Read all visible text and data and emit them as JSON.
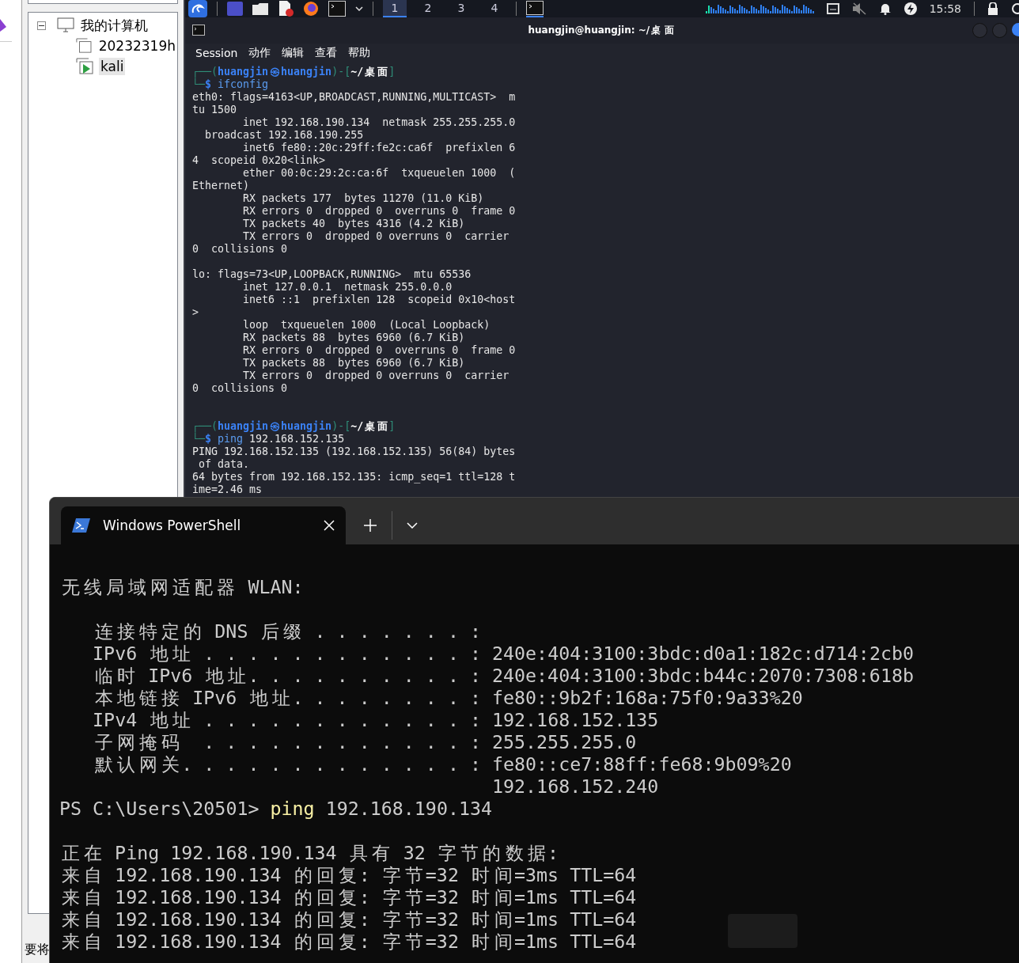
{
  "vm_tree": {
    "root": {
      "label": "我的计算机",
      "expanded": true,
      "children": [
        {
          "label": "20232319h",
          "selected": false,
          "running": false
        },
        {
          "label": "kali",
          "selected": true,
          "running": true
        }
      ]
    }
  },
  "status_text": "要将",
  "kali_panel": {
    "workspaces": [
      {
        "label": "1",
        "selected": true
      },
      {
        "label": "2",
        "selected": false
      },
      {
        "label": "3",
        "selected": false
      },
      {
        "label": "4",
        "selected": false
      }
    ],
    "clock": "15:58"
  },
  "terminal": {
    "title": "huangjin@huangjin: ~/桌面",
    "menu": [
      "Session",
      "动作",
      "编辑",
      "查看",
      "帮助"
    ],
    "lines": [
      {
        "kind": "prompt",
        "segments": [
          {
            "t": "┌──(",
            "kind": "frame"
          },
          {
            "t": "huangjin㉿huangjin",
            "kind": "user"
          },
          {
            "t": ")-[",
            "kind": "frame"
          },
          {
            "t": "~/桌面",
            "kind": "path"
          },
          {
            "t": "]",
            "kind": "frame"
          }
        ]
      },
      {
        "kind": "prompt",
        "segments": [
          {
            "t": "└─",
            "kind": "frame"
          },
          {
            "t": "$",
            "kind": "dollar"
          },
          {
            "t": " ifconfig",
            "kind": "command"
          }
        ]
      },
      {
        "kind": "output",
        "text": "eth0: flags=4163<UP,BROADCAST,RUNNING,MULTICAST>  m"
      },
      {
        "kind": "output",
        "text": "tu 1500"
      },
      {
        "kind": "output",
        "text": "        inet 192.168.190.134  netmask 255.255.255.0"
      },
      {
        "kind": "output",
        "text": "  broadcast 192.168.190.255"
      },
      {
        "kind": "output",
        "text": "        inet6 fe80::20c:29ff:fe2c:ca6f  prefixlen 6"
      },
      {
        "kind": "output",
        "text": "4  scopeid 0x20<link>"
      },
      {
        "kind": "output",
        "text": "        ether 00:0c:29:2c:ca:6f  txqueuelen 1000  ("
      },
      {
        "kind": "output",
        "text": "Ethernet)"
      },
      {
        "kind": "output",
        "text": "        RX packets 177  bytes 11270 (11.0 KiB)"
      },
      {
        "kind": "output",
        "text": "        RX errors 0  dropped 0  overruns 0  frame 0"
      },
      {
        "kind": "output",
        "text": "        TX packets 40  bytes 4316 (4.2 KiB)"
      },
      {
        "kind": "output",
        "text": "        TX errors 0  dropped 0 overruns 0  carrier"
      },
      {
        "kind": "output",
        "text": "0  collisions 0"
      },
      {
        "kind": "blank"
      },
      {
        "kind": "output",
        "text": "lo: flags=73<UP,LOOPBACK,RUNNING>  mtu 65536"
      },
      {
        "kind": "output",
        "text": "        inet 127.0.0.1  netmask 255.0.0.0"
      },
      {
        "kind": "output",
        "text": "        inet6 ::1  prefixlen 128  scopeid 0x10<host"
      },
      {
        "kind": "output",
        "text": ">"
      },
      {
        "kind": "output",
        "text": "        loop  txqueuelen 1000  (Local Loopback)"
      },
      {
        "kind": "output",
        "text": "        RX packets 88  bytes 6960 (6.7 KiB)"
      },
      {
        "kind": "output",
        "text": "        RX errors 0  dropped 0  overruns 0  frame 0"
      },
      {
        "kind": "output",
        "text": "        TX packets 88  bytes 6960 (6.7 KiB)"
      },
      {
        "kind": "output",
        "text": "        TX errors 0  dropped 0 overruns 0  carrier"
      },
      {
        "kind": "output",
        "text": "0  collisions 0"
      },
      {
        "kind": "blank"
      },
      {
        "kind": "blank"
      },
      {
        "kind": "prompt",
        "segments": [
          {
            "t": "┌──(",
            "kind": "frame"
          },
          {
            "t": "huangjin㉿huangjin",
            "kind": "user"
          },
          {
            "t": ")-[",
            "kind": "frame"
          },
          {
            "t": "~/桌面",
            "kind": "path"
          },
          {
            "t": "]",
            "kind": "frame"
          }
        ]
      },
      {
        "kind": "prompt",
        "segments": [
          {
            "t": "└─",
            "kind": "frame"
          },
          {
            "t": "$",
            "kind": "dollar"
          },
          {
            "t": " ping",
            "kind": "command"
          },
          {
            "t": " 192.168.152.135",
            "kind": "plain"
          }
        ]
      },
      {
        "kind": "output",
        "text": "PING 192.168.152.135 (192.168.152.135) 56(84) bytes"
      },
      {
        "kind": "output",
        "text": " of data."
      },
      {
        "kind": "output",
        "text": "64 bytes from 192.168.152.135: icmp_seq=1 ttl=128 t"
      },
      {
        "kind": "output",
        "text": "ime=2.46 ms"
      }
    ]
  },
  "powershell": {
    "tab_title": "Windows PowerShell",
    "lines": [
      {
        "kind": "output",
        "text": "无线局域网适配器 WLAN:"
      },
      {
        "kind": "blank"
      },
      {
        "kind": "output",
        "text": "   连接特定的 DNS 后缀 . . . . . . . :"
      },
      {
        "kind": "output",
        "text": "   IPv6 地址 . . . . . . . . . . . . : 240e:404:3100:3bdc:d0a1:182c:d714:2cb0"
      },
      {
        "kind": "output",
        "text": "   临时 IPv6 地址. . . . . . . . . . : 240e:404:3100:3bdc:b44c:2070:7308:618b"
      },
      {
        "kind": "output",
        "text": "   本地链接 IPv6 地址. . . . . . . . : fe80::9b2f:168a:75f0:9a33%20"
      },
      {
        "kind": "output",
        "text": "   IPv4 地址 . . . . . . . . . . . . : 192.168.152.135"
      },
      {
        "kind": "output",
        "text": "   子网掩码  . . . . . . . . . . . . : 255.255.255.0"
      },
      {
        "kind": "output",
        "text": "   默认网关. . . . . . . . . . . . . : fe80::ce7:88ff:fe68:9b09%20"
      },
      {
        "kind": "output",
        "text": "                                       192.168.152.240"
      },
      {
        "kind": "prompt",
        "prompt": "PS C:\\Users\\20501> ",
        "command": "ping",
        "args": " 192.168.190.134"
      },
      {
        "kind": "blank"
      },
      {
        "kind": "output",
        "text": "正在 Ping 192.168.190.134 具有 32 字节的数据:"
      },
      {
        "kind": "output",
        "text": "来自 192.168.190.134 的回复: 字节=32 时间=3ms TTL=64"
      },
      {
        "kind": "output",
        "text": "来自 192.168.190.134 的回复: 字节=32 时间=1ms TTL=64"
      },
      {
        "kind": "output",
        "text": "来自 192.168.190.134 的回复: 字节=32 时间=1ms TTL=64"
      },
      {
        "kind": "output",
        "text": "来自 192.168.190.134 的回复: 字节=32 时间=1ms TTL=64"
      }
    ]
  }
}
